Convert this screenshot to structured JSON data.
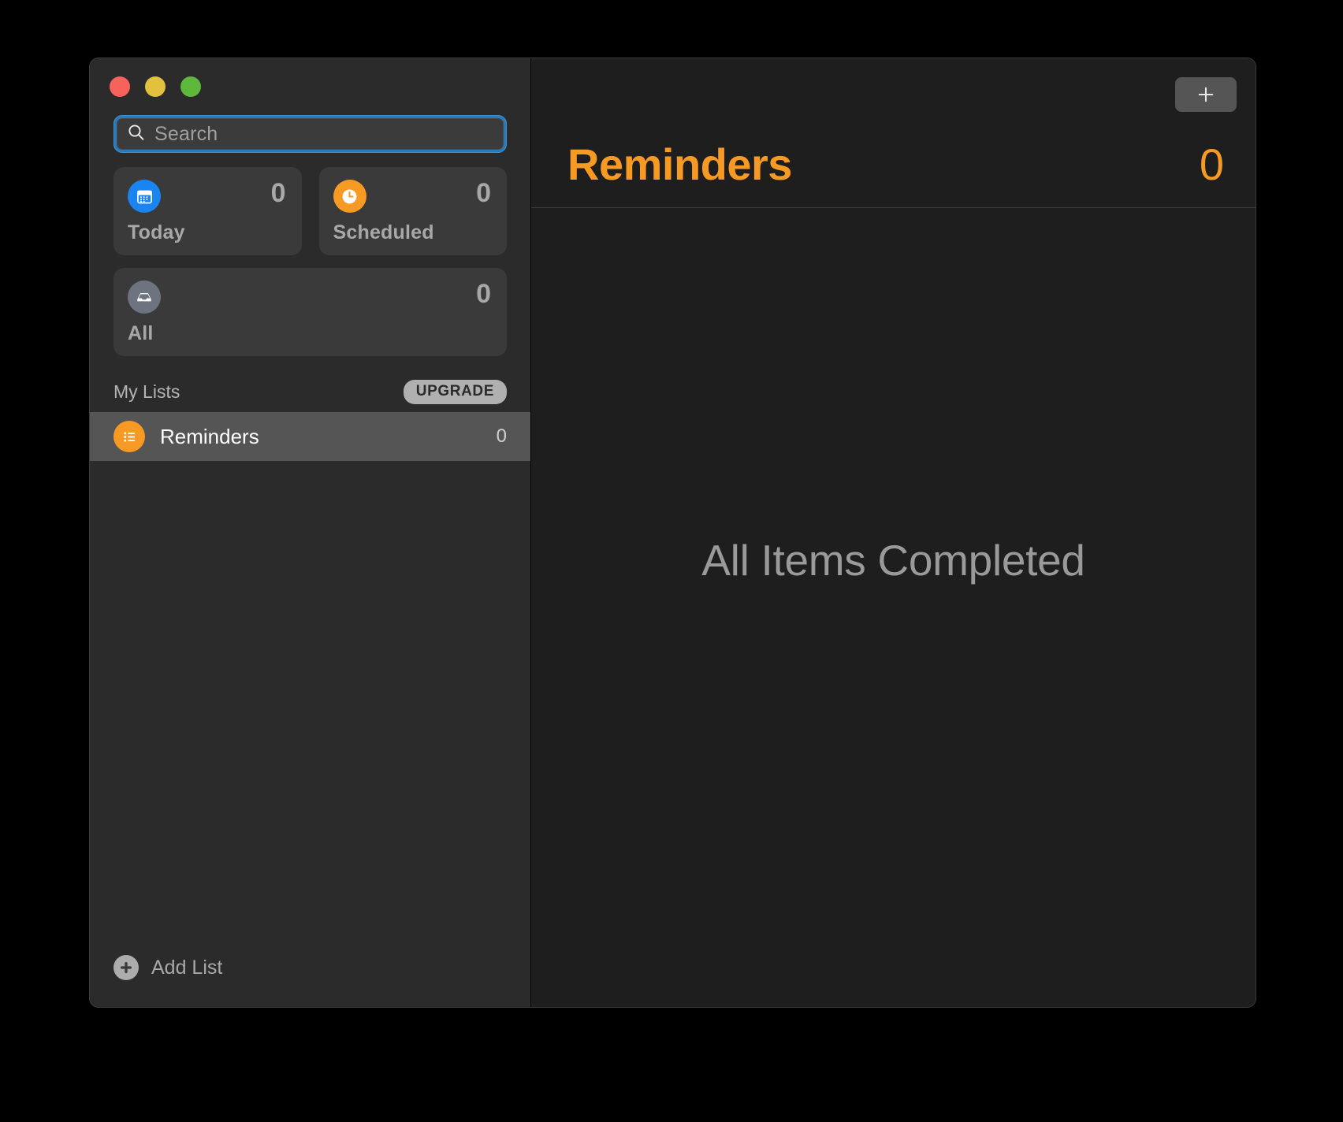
{
  "window": {
    "traffic_lights": [
      {
        "name": "close",
        "color": "#f7625a"
      },
      {
        "name": "minimize",
        "color": "#e2c13e"
      },
      {
        "name": "zoom",
        "color": "#5db83c"
      }
    ]
  },
  "sidebar": {
    "search": {
      "placeholder": "Search",
      "value": "",
      "icon": "search-icon"
    },
    "smart_lists": [
      {
        "id": "today",
        "label": "Today",
        "count": "0",
        "icon": "calendar-icon",
        "color": "#1a84f0"
      },
      {
        "id": "scheduled",
        "label": "Scheduled",
        "count": "0",
        "icon": "clock-icon",
        "color": "#f79a24"
      },
      {
        "id": "all",
        "label": "All",
        "count": "0",
        "icon": "inbox-tray-icon",
        "color": "#6d7480"
      }
    ],
    "my_lists": {
      "header": "My Lists",
      "upgrade_badge": "UPGRADE",
      "items": [
        {
          "name": "Reminders",
          "count": "0",
          "icon": "bulleted-list-icon",
          "color": "#f79a24",
          "selected": true
        }
      ]
    },
    "add_list": {
      "label": "Add List",
      "icon": "plus-circle-icon"
    }
  },
  "content": {
    "title": "Reminders",
    "count": "0",
    "accent_color": "#f79a24",
    "add_button": {
      "icon": "plus-icon",
      "label": "+"
    },
    "empty_state": "All Items Completed"
  }
}
